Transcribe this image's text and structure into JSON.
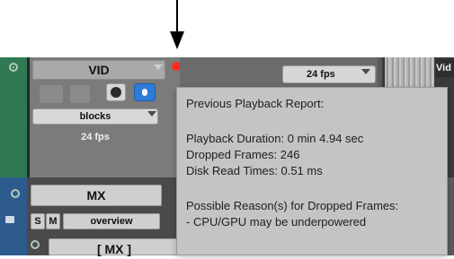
{
  "pointer": {
    "icon": "down-arrow-icon"
  },
  "video_track": {
    "name": "VID",
    "playlist": "blocks",
    "fps": "24 fps",
    "record_ready_icon": "record-red-dot-icon",
    "online_badge": "O"
  },
  "timeline": {
    "fps_dropdown": "24 fps",
    "clip_label": "Vid"
  },
  "mx_track": {
    "name": "MX",
    "solo": "S",
    "mute": "M",
    "view": "overview",
    "next_track_name": "[ MX ]"
  },
  "popup": {
    "title": "Previous Playback Report:",
    "duration": "Playback Duration: 0 min 4.94 sec",
    "dropped": "Dropped Frames: 246",
    "disk": "Disk Read Times: 0.51 ms",
    "reasons_title": "Possible Reason(s) for Dropped Frames:",
    "reason_1": "- CPU/GPU may be underpowered"
  },
  "colors": {
    "video_track": "#2f7a52",
    "mx_track": "#2d5b8d",
    "record": "#ff2a1f",
    "active_blue": "#2f7bd8",
    "popup_bg": "#c4c4c4"
  }
}
